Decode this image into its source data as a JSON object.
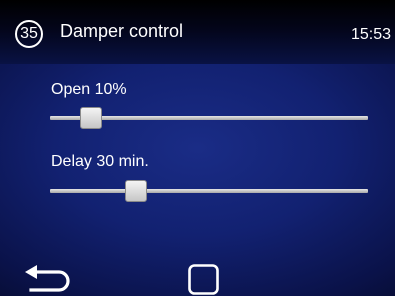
{
  "header": {
    "screen_number": "35",
    "title": "Damper control",
    "time": "15:53"
  },
  "settings": [
    {
      "label": "Open 10%",
      "value": 10,
      "unit": "%",
      "level": 0.13
    },
    {
      "label": "Delay 30 min.",
      "value": 30,
      "unit": "min.",
      "level": 0.27
    }
  ],
  "footer": {
    "back_icon": "return-arrow-icon",
    "home_icon": "square-icon"
  },
  "colors": {
    "background": "#122171",
    "header": "#000000",
    "text": "#ffffff",
    "slider_track": "#c8c8c8",
    "slider_thumb": "#e0e0e0"
  }
}
